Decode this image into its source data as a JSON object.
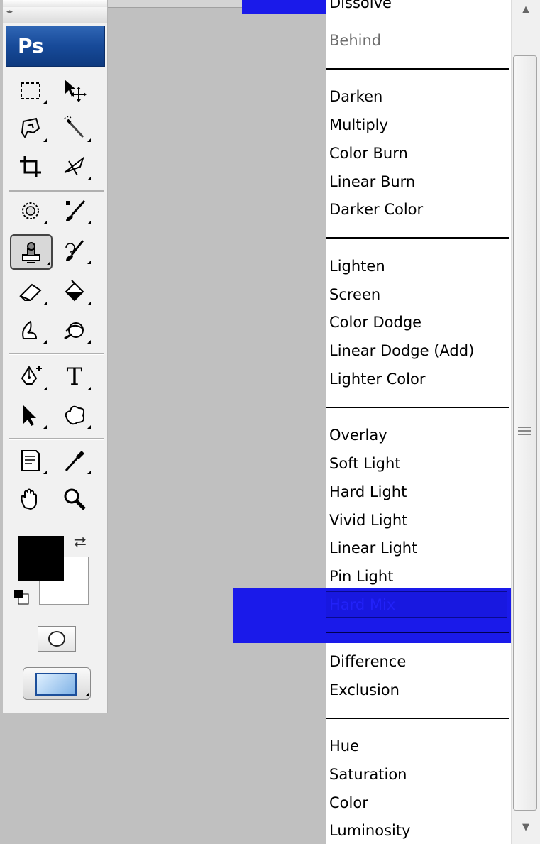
{
  "toolbox": {
    "logo": "Ps",
    "tools": [
      {
        "name": "rectangular-marquee-tool-icon"
      },
      {
        "name": "move-tool-icon"
      },
      {
        "name": "lasso-tool-icon"
      },
      {
        "name": "quick-selection-tool-icon"
      },
      {
        "name": "crop-tool-icon"
      },
      {
        "name": "slice-tool-icon"
      },
      {
        "name": "spot-healing-brush-icon"
      },
      {
        "name": "brush-tool-icon"
      },
      {
        "name": "clone-stamp-tool-icon"
      },
      {
        "name": "history-brush-icon"
      },
      {
        "name": "eraser-tool-icon"
      },
      {
        "name": "paint-bucket-icon"
      },
      {
        "name": "blur-tool-icon"
      },
      {
        "name": "dodge-tool-icon"
      },
      {
        "name": "pen-tool-icon"
      },
      {
        "name": "type-tool-icon"
      },
      {
        "name": "path-selection-tool-icon"
      },
      {
        "name": "custom-shape-tool-icon"
      },
      {
        "name": "notes-tool-icon"
      },
      {
        "name": "eyedropper-tool-icon"
      },
      {
        "name": "hand-tool-icon"
      },
      {
        "name": "zoom-tool-icon"
      }
    ],
    "type_glyph": "T",
    "foreground_color": "#000000",
    "background_color": "#ffffff"
  },
  "blend_modes": {
    "highlighted_partial": "Dissolve",
    "groups": [
      [
        "Behind"
      ],
      [
        "Darken",
        "Multiply",
        "Color Burn",
        "Linear Burn",
        "Darker Color"
      ],
      [
        "Lighten",
        "Screen",
        "Color Dodge",
        "Linear Dodge (Add)",
        "Lighter Color"
      ],
      [
        "Overlay",
        "Soft Light",
        "Hard Light",
        "Vivid Light",
        "Linear Light",
        "Pin Light"
      ],
      [
        "Difference",
        "Exclusion"
      ],
      [
        "Hue",
        "Saturation",
        "Color",
        "Luminosity"
      ]
    ],
    "selected": "Hard Mix",
    "highlight_color": "#1a1aea"
  },
  "scrollbar": {
    "up_arrow": "▲",
    "down_arrow": "▼"
  }
}
